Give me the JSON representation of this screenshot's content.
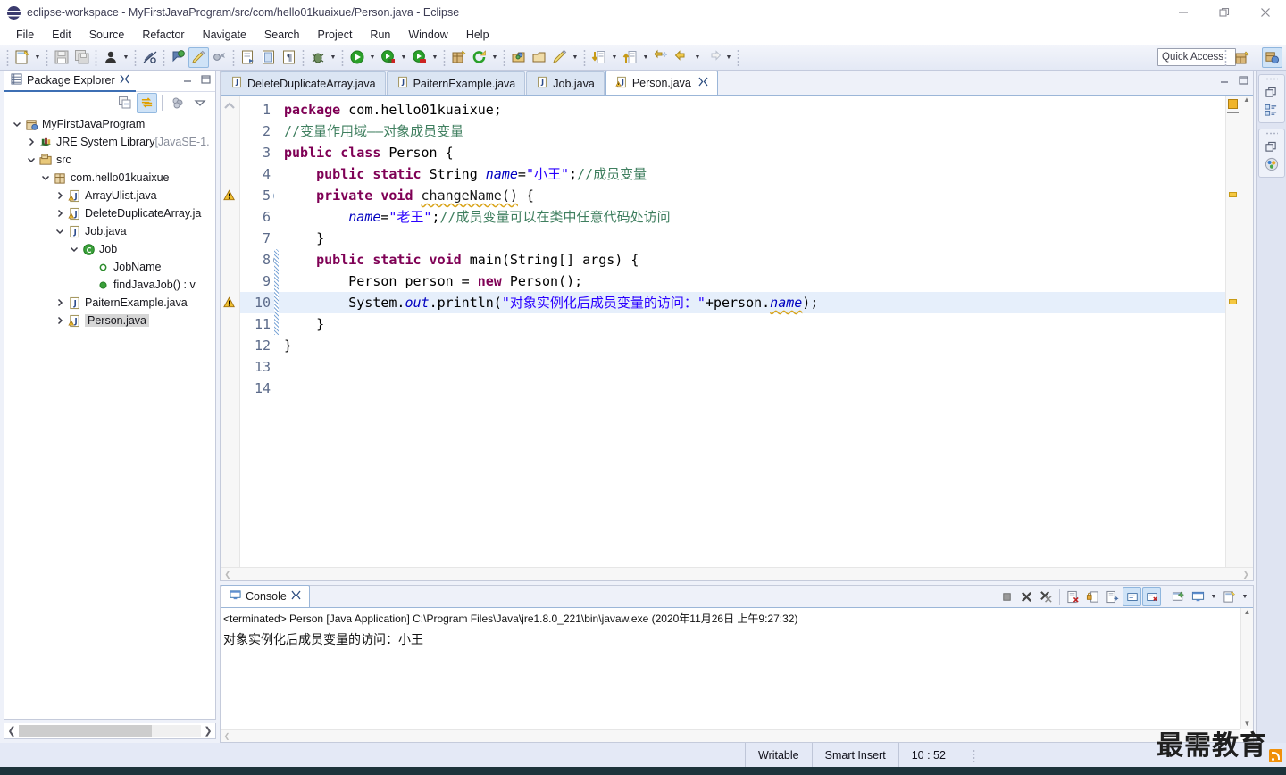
{
  "window": {
    "title": "eclipse-workspace - MyFirstJavaProgram/src/com/hello01kuaixue/Person.java - Eclipse",
    "logo_icon": "eclipse-logo-icon",
    "minimize_label": "—",
    "restore_label": "❐",
    "close_label": "✕"
  },
  "menu": {
    "items": [
      {
        "label": "File"
      },
      {
        "label": "Edit"
      },
      {
        "label": "Source"
      },
      {
        "label": "Refactor"
      },
      {
        "label": "Navigate"
      },
      {
        "label": "Search"
      },
      {
        "label": "Project"
      },
      {
        "label": "Run"
      },
      {
        "label": "Window"
      },
      {
        "label": "Help"
      }
    ]
  },
  "toolbar": {
    "quick_access_placeholder": "Quick Access",
    "buttons": [
      {
        "name": "new-wizard-icon"
      },
      {
        "name": "save-icon"
      },
      {
        "name": "save-all-icon"
      },
      {
        "name": "person-icon"
      },
      {
        "name": "toggle-breakpoint-icon"
      },
      {
        "name": "skip-breakpoints-icon"
      },
      {
        "name": "toggle-mark-occurrences-icon"
      },
      {
        "name": "new-java-package-icon"
      },
      {
        "name": "open-type-icon"
      },
      {
        "name": "open-task-icon"
      },
      {
        "name": "debug-icon"
      },
      {
        "name": "run-icon"
      },
      {
        "name": "run-last-tool-icon"
      },
      {
        "name": "external-tools-icon"
      },
      {
        "name": "new-java-project-icon"
      },
      {
        "name": "refresh-icon"
      },
      {
        "name": "open-perspective-icon"
      },
      {
        "name": "close-perspective-icon"
      },
      {
        "name": "pencil-icon"
      },
      {
        "name": "next-annotation-icon"
      },
      {
        "name": "previous-annotation-icon"
      },
      {
        "name": "last-edit-location-icon"
      },
      {
        "name": "back-icon"
      },
      {
        "name": "forward-icon"
      }
    ],
    "perspective_buttons": [
      {
        "name": "open-perspective-icon"
      },
      {
        "name": "java-perspective-icon"
      }
    ]
  },
  "package_explorer": {
    "title": "Package Explorer",
    "title_icon": "package-explorer-icon",
    "close_icon": "close-icon",
    "minimize_icon": "minimize-icon",
    "maximize_icon": "maximize-icon",
    "toolbar": [
      {
        "name": "collapse-all-icon"
      },
      {
        "name": "link-with-editor-icon"
      },
      {
        "name": "focus-on-active-task-icon"
      },
      {
        "name": "view-menu-icon"
      }
    ],
    "tree": [
      {
        "indent": 0,
        "twisty": "open",
        "icon": "java-project-icon",
        "label": "MyFirstJavaProgram",
        "dim": "",
        "selected": false
      },
      {
        "indent": 1,
        "twisty": "closed",
        "icon": "jre-library-icon",
        "label": "JRE System Library ",
        "dim": "[JavaSE-1.",
        "selected": false
      },
      {
        "indent": 1,
        "twisty": "open",
        "icon": "source-folder-icon",
        "label": "src",
        "dim": "",
        "selected": false
      },
      {
        "indent": 2,
        "twisty": "open",
        "icon": "package-icon",
        "label": "com.hello01kuaixue",
        "dim": "",
        "selected": false
      },
      {
        "indent": 3,
        "twisty": "closed",
        "icon": "java-file-warn-icon",
        "label": "ArrayUlist.java",
        "dim": "",
        "selected": false
      },
      {
        "indent": 3,
        "twisty": "closed",
        "icon": "java-file-warn-icon",
        "label": "DeleteDuplicateArray.ja",
        "dim": "",
        "selected": false
      },
      {
        "indent": 3,
        "twisty": "open",
        "icon": "java-file-icon",
        "label": "Job.java",
        "dim": "",
        "selected": false
      },
      {
        "indent": 4,
        "twisty": "open",
        "icon": "class-icon",
        "label": "Job",
        "dim": "",
        "selected": false
      },
      {
        "indent": 5,
        "twisty": "none",
        "icon": "field-public-icon",
        "label": "JobName",
        "dim": "",
        "selected": false
      },
      {
        "indent": 5,
        "twisty": "none",
        "icon": "method-public-icon",
        "label": "findJavaJob() : v",
        "dim": "",
        "selected": false
      },
      {
        "indent": 3,
        "twisty": "closed",
        "icon": "java-file-icon",
        "label": "PaiternExample.java",
        "dim": "",
        "selected": false
      },
      {
        "indent": 3,
        "twisty": "closed",
        "icon": "java-file-warn-icon",
        "label": "Person.java",
        "dim": "",
        "selected": true
      }
    ]
  },
  "editor": {
    "tabs": [
      {
        "label": "DeleteDuplicateArray.java",
        "icon": "java-file-icon",
        "active": false,
        "closeable": false
      },
      {
        "label": "PaiternExample.java",
        "icon": "java-file-icon",
        "active": false,
        "closeable": false
      },
      {
        "label": "Job.java",
        "icon": "java-file-icon",
        "active": false,
        "closeable": false
      },
      {
        "label": "Person.java",
        "icon": "java-file-warn-icon",
        "active": true,
        "closeable": true
      }
    ],
    "tab_close_icon": "close-icon",
    "minimize_icon": "minimize-icon",
    "maximize_icon": "maximize-icon",
    "current_line": 10,
    "lines": [
      {
        "num": 1,
        "fold": "",
        "warn": false,
        "tokens": [
          {
            "t": "package ",
            "c": "kw"
          },
          {
            "t": "com.hello01kuaixue;",
            "c": "pl"
          }
        ]
      },
      {
        "num": 2,
        "fold": "",
        "warn": false,
        "tokens": [
          {
            "t": "//变量作用域——对象成员变量",
            "c": "cm"
          }
        ]
      },
      {
        "num": 3,
        "fold": "",
        "warn": false,
        "tokens": [
          {
            "t": "public class ",
            "c": "kw"
          },
          {
            "t": "Person {",
            "c": "pl"
          }
        ]
      },
      {
        "num": 4,
        "fold": "",
        "warn": false,
        "tokens": [
          {
            "t": "    ",
            "c": "pl"
          },
          {
            "t": "public static ",
            "c": "kw"
          },
          {
            "t": "String ",
            "c": "pl"
          },
          {
            "t": "name",
            "c": "fld"
          },
          {
            "t": "=",
            "c": "pl"
          },
          {
            "t": "\"小王\"",
            "c": "st"
          },
          {
            "t": ";",
            "c": "pl"
          },
          {
            "t": "//成员变量",
            "c": "cm"
          }
        ]
      },
      {
        "num": 5,
        "fold": "fold",
        "warn": true,
        "tokens": [
          {
            "t": "    ",
            "c": "pl"
          },
          {
            "t": "private void ",
            "c": "kw"
          },
          {
            "t": "changeName()",
            "c": "sq"
          },
          {
            "t": " {",
            "c": "pl"
          }
        ]
      },
      {
        "num": 6,
        "fold": "",
        "warn": false,
        "tokens": [
          {
            "t": "        ",
            "c": "pl"
          },
          {
            "t": "name",
            "c": "fld"
          },
          {
            "t": "=",
            "c": "pl"
          },
          {
            "t": "\"老王\"",
            "c": "st"
          },
          {
            "t": ";",
            "c": "pl"
          },
          {
            "t": "//成员变量可以在类中任意代码处访问",
            "c": "cm"
          }
        ]
      },
      {
        "num": 7,
        "fold": "",
        "warn": false,
        "tokens": [
          {
            "t": "    }",
            "c": "pl"
          }
        ]
      },
      {
        "num": 8,
        "fold": "fold",
        "warn": false,
        "tokens": [
          {
            "t": "    ",
            "c": "pl"
          },
          {
            "t": "public static void ",
            "c": "kw"
          },
          {
            "t": "main(String[] args) {",
            "c": "pl"
          }
        ]
      },
      {
        "num": 9,
        "fold": "",
        "warn": false,
        "tokens": [
          {
            "t": "        Person person = ",
            "c": "pl"
          },
          {
            "t": "new ",
            "c": "kw"
          },
          {
            "t": "Person();",
            "c": "pl"
          }
        ]
      },
      {
        "num": 10,
        "fold": "",
        "warn": true,
        "tokens": [
          {
            "t": "        System.",
            "c": "pl"
          },
          {
            "t": "out",
            "c": "fld"
          },
          {
            "t": ".println(",
            "c": "pl"
          },
          {
            "t": "\"对象实例化后成员变量的访问：\"",
            "c": "st"
          },
          {
            "t": "+person.",
            "c": "pl"
          },
          {
            "t": "name",
            "c": "fld sq"
          },
          {
            "t": ");",
            "c": "pl"
          }
        ]
      },
      {
        "num": 11,
        "fold": "",
        "warn": false,
        "tokens": [
          {
            "t": "    }",
            "c": "pl"
          }
        ]
      },
      {
        "num": 12,
        "fold": "",
        "warn": false,
        "tokens": [
          {
            "t": "}",
            "c": "pl"
          }
        ]
      },
      {
        "num": 13,
        "fold": "",
        "warn": false,
        "tokens": []
      },
      {
        "num": 14,
        "fold": "",
        "warn": false,
        "tokens": []
      }
    ]
  },
  "console": {
    "title": "Console",
    "title_icon": "console-icon",
    "close_icon": "close-icon",
    "terminated_line": "<terminated> Person [Java Application] C:\\Program Files\\Java\\jre1.8.0_221\\bin\\javaw.exe (2020年11月26日 上午9:27:32)",
    "output": "对象实例化后成员变量的访问：小王",
    "toolbar": [
      {
        "name": "terminate-icon",
        "selected": false
      },
      {
        "name": "remove-launch-icon",
        "selected": false
      },
      {
        "name": "remove-all-launches-icon",
        "selected": false
      },
      {
        "name": "clear-console-icon",
        "selected": false
      },
      {
        "name": "scroll-lock-icon",
        "selected": false
      },
      {
        "name": "word-wrap-icon",
        "selected": false
      },
      {
        "name": "show-console-on-output-icon",
        "selected": true
      },
      {
        "name": "show-console-on-error-icon",
        "selected": true
      },
      {
        "name": "pin-console-icon",
        "selected": false
      },
      {
        "name": "display-selected-console-icon",
        "selected": false
      },
      {
        "name": "open-console-icon",
        "selected": false
      }
    ]
  },
  "fast_view_bar": {
    "stacks": [
      {
        "grip_icon": "drag-grip-icon",
        "restore_icon": "restore-icon",
        "view_icon": "outline-icon"
      },
      {
        "grip_icon": "drag-grip-icon",
        "restore_icon": "restore-icon",
        "view_icon": "task-list-icon"
      }
    ]
  },
  "status_bar": {
    "writable": "Writable",
    "insert_mode": "Smart Insert",
    "position": "10 : 52"
  },
  "watermark": {
    "text": "最需教育",
    "icon": "rss-icon"
  },
  "colors": {
    "accent": "#3d6fb4",
    "keyword": "#7f0055",
    "string": "#2a00ff",
    "comment": "#3f7f5f",
    "field": "#0000c0",
    "warning": "#f5c842",
    "selection": "#e6effb"
  }
}
